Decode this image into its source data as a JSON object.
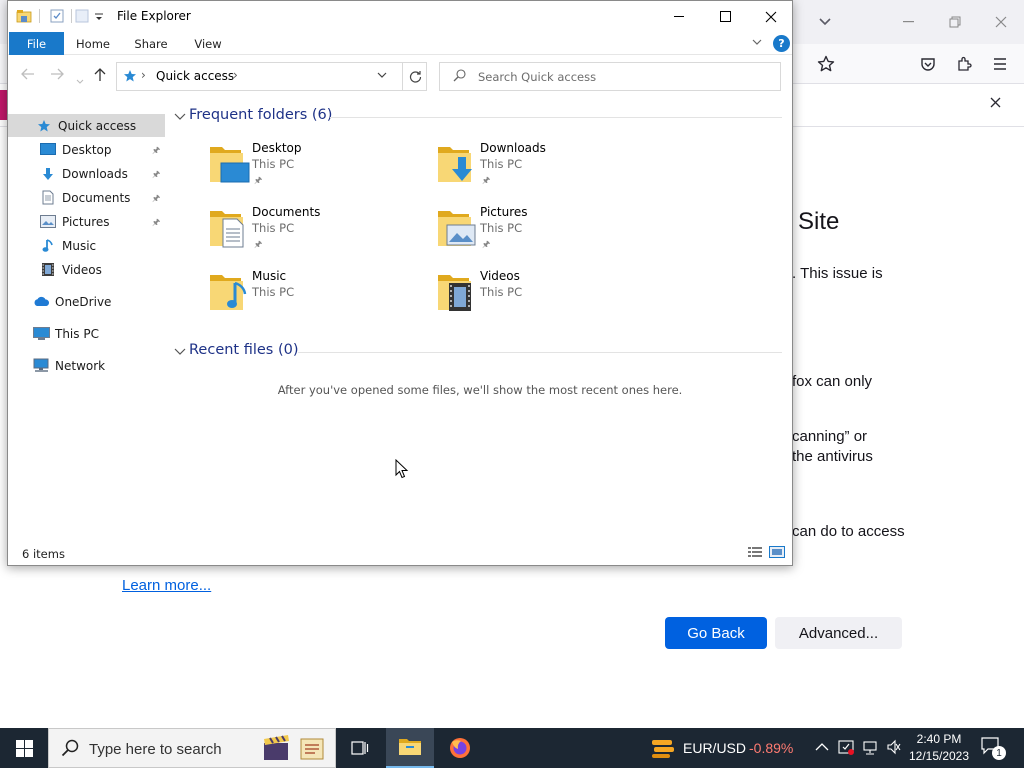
{
  "browser": {
    "heading_fragment": "Site",
    "lines": [
      ". This issue is",
      "fox can only",
      "canning” or",
      "the antivirus",
      "can do to access"
    ],
    "learn_more": "Learn more...",
    "go_back": "Go Back",
    "advanced": "Advanced..."
  },
  "explorer": {
    "title": "File Explorer",
    "ribbon": {
      "file": "File",
      "home": "Home",
      "share": "Share",
      "view": "View",
      "help": "?"
    },
    "address": {
      "location": "Quick access",
      "separator": "›"
    },
    "search": {
      "placeholder": "Search Quick access"
    },
    "nav": {
      "quick_access": "Quick access",
      "items": [
        {
          "label": "Desktop",
          "icon": "desktop-icon",
          "pinned": true
        },
        {
          "label": "Downloads",
          "icon": "downloads-icon",
          "pinned": true
        },
        {
          "label": "Documents",
          "icon": "documents-icon",
          "pinned": true
        },
        {
          "label": "Pictures",
          "icon": "pictures-icon",
          "pinned": true
        },
        {
          "label": "Music",
          "icon": "music-icon",
          "pinned": false
        },
        {
          "label": "Videos",
          "icon": "videos-icon",
          "pinned": false
        }
      ],
      "onedrive": "OneDrive",
      "this_pc": "This PC",
      "network": "Network"
    },
    "frequent": {
      "header": "Frequent folders (6)",
      "folders": [
        {
          "name": "Desktop",
          "location": "This PC",
          "pinned": true
        },
        {
          "name": "Downloads",
          "location": "This PC",
          "pinned": true
        },
        {
          "name": "Documents",
          "location": "This PC",
          "pinned": true
        },
        {
          "name": "Pictures",
          "location": "This PC",
          "pinned": true
        },
        {
          "name": "Music",
          "location": "This PC",
          "pinned": false
        },
        {
          "name": "Videos",
          "location": "This PC",
          "pinned": false
        }
      ]
    },
    "recent": {
      "header": "Recent files (0)",
      "empty_message": "After you've opened some files, we'll show the most recent ones here."
    },
    "status": {
      "item_count": "6 items"
    }
  },
  "taskbar": {
    "search_placeholder": "Type here to search",
    "ticker_name": "EUR/USD",
    "ticker_value": "-0.89%",
    "time": "2:40 PM",
    "date": "12/15/2023",
    "notification_count": "1"
  },
  "colors": {
    "accent": "#1979ca",
    "folder_yellow": "#f8d775",
    "folder_dark": "#e0a91e",
    "taskbar": "#1c2733",
    "firefox_button": "#0061e0",
    "ticker_negative": "#ff7b72"
  }
}
